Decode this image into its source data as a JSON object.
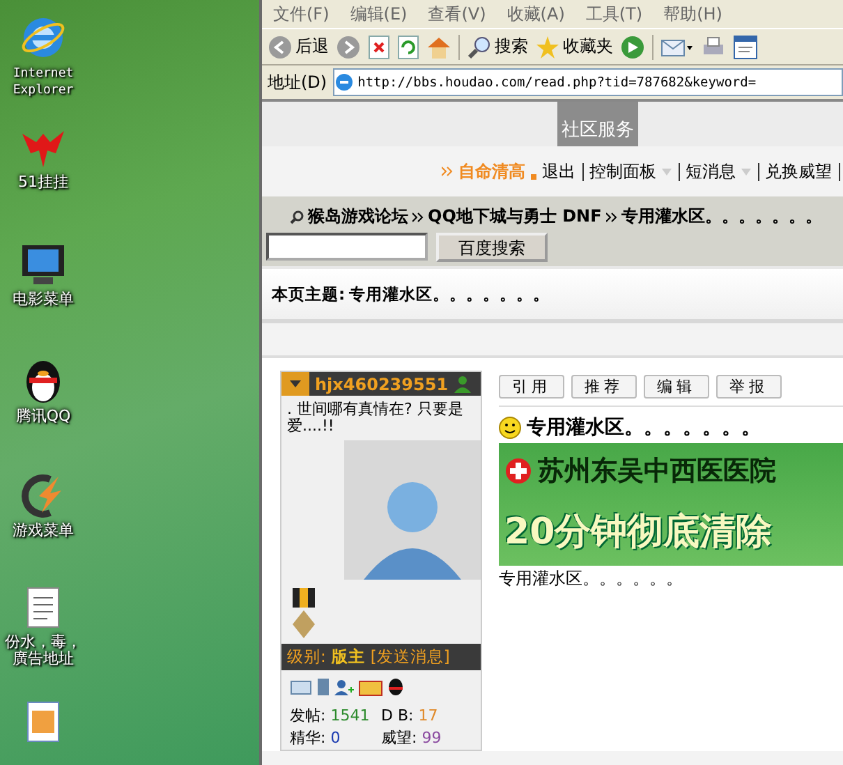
{
  "desktop": {
    "icons": [
      {
        "label": "Internet Explorer",
        "kind": "ie"
      },
      {
        "label": "51挂挂",
        "kind": "bat"
      },
      {
        "label": "电影菜单",
        "kind": "monitor"
      },
      {
        "label": "腾讯QQ",
        "kind": "penguin"
      },
      {
        "label": "游戏菜单",
        "kind": "game"
      },
      {
        "label": "份水，毒，廣告地址",
        "kind": "document"
      },
      {
        "kind": "image"
      }
    ]
  },
  "browser": {
    "menu": [
      "文件(F)",
      "编辑(E)",
      "查看(V)",
      "收藏(A)",
      "工具(T)",
      "帮助(H)"
    ],
    "toolbar": [
      {
        "kind": "back",
        "label": "后退"
      },
      {
        "kind": "forward"
      },
      {
        "kind": "stop"
      },
      {
        "kind": "refresh"
      },
      {
        "kind": "home"
      },
      {
        "kind": "search",
        "label": "搜索"
      },
      {
        "kind": "favorites",
        "label": "收藏夹"
      },
      {
        "kind": "media"
      },
      {
        "kind": "mail"
      },
      {
        "kind": "print"
      },
      {
        "kind": "edit"
      }
    ],
    "address": {
      "label": "地址(D)",
      "url": "http://bbs.houdao.com/read.php?tid=787682&keyword="
    }
  },
  "page": {
    "service_tab": "社区服务",
    "user_bar": {
      "username": "自命清高",
      "links": [
        {
          "label": "退出",
          "dropdown": false
        },
        {
          "label": "控制面板",
          "dropdown": true
        },
        {
          "label": "短消息",
          "dropdown": true
        },
        {
          "label": "兑换威望",
          "dropdown": false
        }
      ]
    },
    "breadcrumb": [
      "猴岛游戏论坛",
      "QQ地下城与勇士 DNF",
      "专用灌水区。。。。。。。"
    ],
    "search_button": "百度搜索",
    "topic": {
      "label": "本页主题:",
      "title": "专用灌水区。。。。。。。"
    },
    "post": {
      "author": {
        "name": "hjx460239551",
        "signature": ". 世间哪有真情在? 只要是爱....!!",
        "level_label": "级别:",
        "level": "版主",
        "message_link": "[发送消息]",
        "stats": [
          {
            "label": "发帖:",
            "value": "1541",
            "color": "#2a8a2a"
          },
          {
            "label": "D B:",
            "value": "17",
            "color": "#e08a2a"
          },
          {
            "label": "精华:",
            "value": "0",
            "color": "#1a3ab0"
          },
          {
            "label": "威望:",
            "value": "99",
            "color": "#8a4aa0"
          }
        ]
      },
      "buttons": [
        "引用",
        "推荐",
        "编辑",
        "举报"
      ],
      "title": "专用灌水区。。。。。。。",
      "ad": {
        "line_1": "苏州东吴中西医医院",
        "line_2": "20分钟彻底清除"
      },
      "body": "专用灌水区。。。。。。"
    }
  }
}
